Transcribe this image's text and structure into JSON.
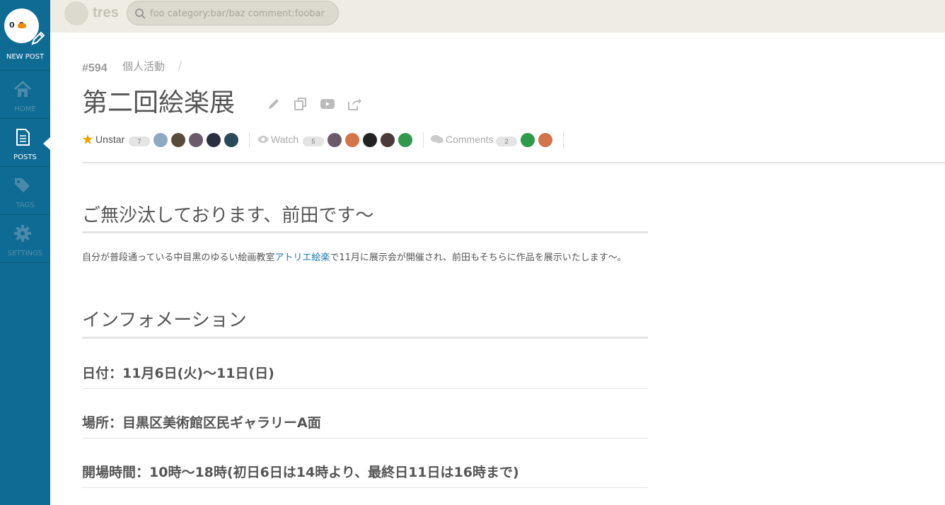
{
  "sidebar": {
    "new_post_label": "NEW POST",
    "logo_text": "0 0",
    "items": [
      {
        "label": "HOME",
        "icon": "home-icon"
      },
      {
        "label": "POSTS",
        "icon": "posts-icon"
      },
      {
        "label": "TAGS",
        "icon": "tags-icon"
      },
      {
        "label": "SETTINGS",
        "icon": "gear-icon"
      }
    ]
  },
  "header": {
    "brand": "tres",
    "search_placeholder": "foo category:bar/baz comment:foobar"
  },
  "post": {
    "id": "#594",
    "category": "個人活動",
    "category_sep": "/",
    "title": "第二回絵楽展",
    "star_label": "Unstar",
    "star_count": "7",
    "watch_label": "Watch",
    "watch_count": "5",
    "comments_label": "Comments",
    "comments_count": "2"
  },
  "content": {
    "h2_greeting": "ご無沙汰しております、前田です〜",
    "para_before_link": "自分が普段通っている中目黒のゆるい絵画教室",
    "para_link": "アトリエ絵楽",
    "para_after_link": "で11月に展示会が開催され、前田もそちらに作品を展示いたします〜。",
    "h2_info": "インフォメーション",
    "date_line": "日付：11月6日(火)〜11日(日)",
    "place_line": "場所：目黒区美術館区民ギャラリーA面",
    "hours_line": "開場時間：10時〜18時(初日6日は14時より、最終日11日は16時まで)"
  },
  "colors": {
    "sidebar": "#0e6b94",
    "topbar": "#efede3",
    "star": "#f0a500",
    "link": "#1a7bb0"
  }
}
